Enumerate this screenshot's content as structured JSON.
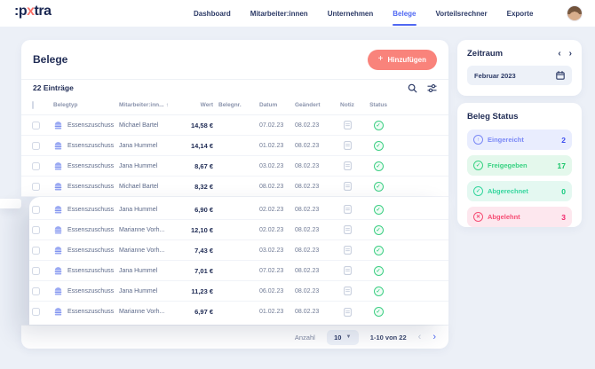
{
  "brand": {
    "prefix": ":p",
    "accent": "x",
    "suffix": "tra"
  },
  "nav": {
    "items": [
      {
        "label": "Dashboard"
      },
      {
        "label": "Mitarbeiter:innen"
      },
      {
        "label": "Unternehmen"
      },
      {
        "label": "Belege"
      },
      {
        "label": "Vorteilsrechner"
      },
      {
        "label": "Exporte"
      }
    ],
    "active": "Belege"
  },
  "page": {
    "title": "Belege",
    "add_button": "Hinzufügen",
    "entries": "22 Einträge"
  },
  "table": {
    "columns": {
      "belegtyp": "Belegtyp",
      "mitarbeiter": "Mitarbeiter:inn...",
      "sort_arrow": "↑",
      "wert": "Wert",
      "belegnr": "Belegnr.",
      "datum": "Datum",
      "geaendert": "Geändert",
      "notiz": "Notiz",
      "status": "Status"
    },
    "rows": [
      {
        "type": "Essenszuschuss",
        "employee": "Michael Bartel",
        "wert": "14,58 €",
        "belegnr": "",
        "datum": "07.02.23",
        "geaendert": "08.02.23",
        "status": "freigegeben"
      },
      {
        "type": "Essenszuschuss",
        "employee": "Jana Hummel",
        "wert": "14,14 €",
        "belegnr": "",
        "datum": "01.02.23",
        "geaendert": "08.02.23",
        "status": "freigegeben"
      },
      {
        "type": "Essenszuschuss",
        "employee": "Jana Hummel",
        "wert": "8,67 €",
        "belegnr": "",
        "datum": "03.02.23",
        "geaendert": "08.02.23",
        "status": "freigegeben"
      },
      {
        "type": "Essenszuschuss",
        "employee": "Michael Bartel",
        "wert": "8,32 €",
        "belegnr": "",
        "datum": "08.02.23",
        "geaendert": "08.02.23",
        "status": "freigegeben"
      },
      {
        "type": "Essenszuschuss",
        "employee": "Jana Hummel",
        "wert": "6,90 €",
        "belegnr": "",
        "datum": "02.02.23",
        "geaendert": "08.02.23",
        "status": "freigegeben"
      },
      {
        "type": "Essenszuschuss",
        "employee": "Marianne Vorh...",
        "wert": "12,10 €",
        "belegnr": "",
        "datum": "02.02.23",
        "geaendert": "08.02.23",
        "status": "freigegeben"
      },
      {
        "type": "Essenszuschuss",
        "employee": "Marianne Vorh...",
        "wert": "7,43 €",
        "belegnr": "",
        "datum": "03.02.23",
        "geaendert": "08.02.23",
        "status": "freigegeben"
      },
      {
        "type": "Essenszuschuss",
        "employee": "Jana Hummel",
        "wert": "7,01 €",
        "belegnr": "",
        "datum": "07.02.23",
        "geaendert": "08.02.23",
        "status": "freigegeben"
      },
      {
        "type": "Essenszuschuss",
        "employee": "Jana Hummel",
        "wert": "11,23 €",
        "belegnr": "",
        "datum": "06.02.23",
        "geaendert": "08.02.23",
        "status": "freigegeben"
      },
      {
        "type": "Essenszuschuss",
        "employee": "Marianne Vorh...",
        "wert": "6,97 €",
        "belegnr": "",
        "datum": "01.02.23",
        "geaendert": "08.02.23",
        "status": "freigegeben"
      }
    ],
    "rows_in_top_card": 4
  },
  "pagination": {
    "label": "Anzahl",
    "page_size": "10",
    "range": "1-10 von 22",
    "prev": "‹",
    "next": "›"
  },
  "zeitraum": {
    "title": "Zeitraum",
    "value": "Februar 2023",
    "prev": "‹",
    "next": "›"
  },
  "beleg_status": {
    "title": "Beleg Status",
    "items": [
      {
        "label": "Eingereicht",
        "count": "2",
        "glyph": "↑",
        "icon": "submitted-circle-icon",
        "bg": "#e9edfe",
        "fg": "#7b89f6",
        "count_color": "#3d4ef0"
      },
      {
        "label": "Freigegeben",
        "count": "17",
        "glyph": "✓",
        "icon": "approved-circle-icon",
        "bg": "#e4f8ec",
        "fg": "#38d282",
        "count_color": "#17c468"
      },
      {
        "label": "Abgerechnet",
        "count": "0",
        "glyph": "✓",
        "icon": "settled-circle-icon",
        "bg": "#e4f8f1",
        "fg": "#35d69e",
        "count_color": "#14ca7e"
      },
      {
        "label": "Abgelehnt",
        "count": "3",
        "glyph": "✕",
        "icon": "rejected-circle-icon",
        "bg": "#fde7ee",
        "fg": "#f64d74",
        "count_color": "#f2246a"
      }
    ]
  },
  "colors": {
    "accent_coral": "#f9837b",
    "accent_blue": "#5068f2",
    "navy": "#1f2b54",
    "status_green": "#3ecf84"
  }
}
